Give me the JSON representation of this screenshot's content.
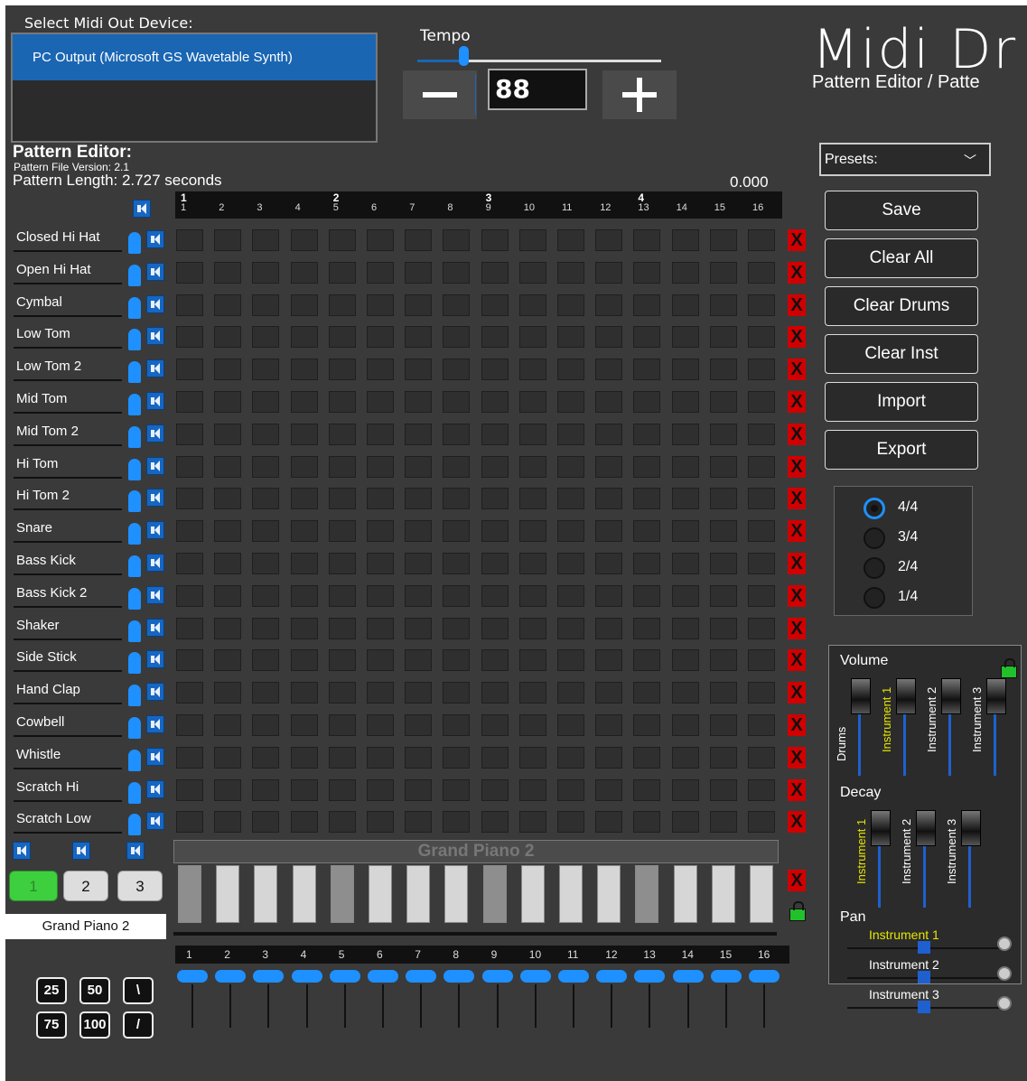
{
  "device": {
    "label": "Select Midi Out Device:",
    "selected": "PC Output (Microsoft GS Wavetable Synth)"
  },
  "tempo": {
    "label": "Tempo",
    "value": "88",
    "minus": "—",
    "plus": "+"
  },
  "brand": {
    "title": "Midi Dr",
    "subtitle": "Pattern Editor / Patte"
  },
  "editor": {
    "title": "Pattern Editor:",
    "version": "Pattern File Version: 2.1",
    "length": "Pattern Length: 2.727 seconds",
    "position": "0.000"
  },
  "ruler": {
    "bars": [
      "1",
      "2",
      "3",
      "4"
    ],
    "steps": [
      "1",
      "2",
      "3",
      "4",
      "5",
      "6",
      "7",
      "8",
      "9",
      "10",
      "11",
      "12",
      "13",
      "14",
      "15",
      "16"
    ]
  },
  "drums": [
    "Closed Hi Hat",
    "Open Hi Hat",
    "Cymbal",
    "Low Tom",
    "Low Tom 2",
    "Mid Tom",
    "Mid Tom 2",
    "Hi Tom",
    "Hi Tom 2",
    "Snare",
    "Bass Kick",
    "Bass Kick 2",
    "Shaker",
    "Side Stick",
    "Hand Clap",
    "Cowbell",
    "Whistle",
    "Scratch Hi",
    "Scratch Low"
  ],
  "clear_x": "X",
  "presets": {
    "label": "Presets:"
  },
  "buttons": {
    "save": "Save",
    "clear_all": "Clear All",
    "clear_drums": "Clear Drums",
    "clear_inst": "Clear Inst",
    "import": "Import",
    "export": "Export"
  },
  "time_signatures": [
    "4/4",
    "3/4",
    "2/4",
    "1/4"
  ],
  "mixer": {
    "volume": "Volume",
    "decay": "Decay",
    "pan": "Pan",
    "vol_channels": [
      "Drums",
      "Instrument 1",
      "Instrument 2",
      "Instrument 3"
    ],
    "decay_channels": [
      "Instrument 1",
      "Instrument 2",
      "Instrument 3"
    ],
    "pan_channels": [
      "Instrument 1",
      "Instrument 2",
      "Instrument 3"
    ],
    "active_color": "#e6e600"
  },
  "instrument": {
    "name": "Grand Piano 2",
    "channels": [
      "1",
      "2",
      "3"
    ],
    "selected_label": "Grand Piano 2"
  },
  "quantize": [
    "25",
    "50",
    "\\",
    "75",
    "100",
    "/"
  ]
}
